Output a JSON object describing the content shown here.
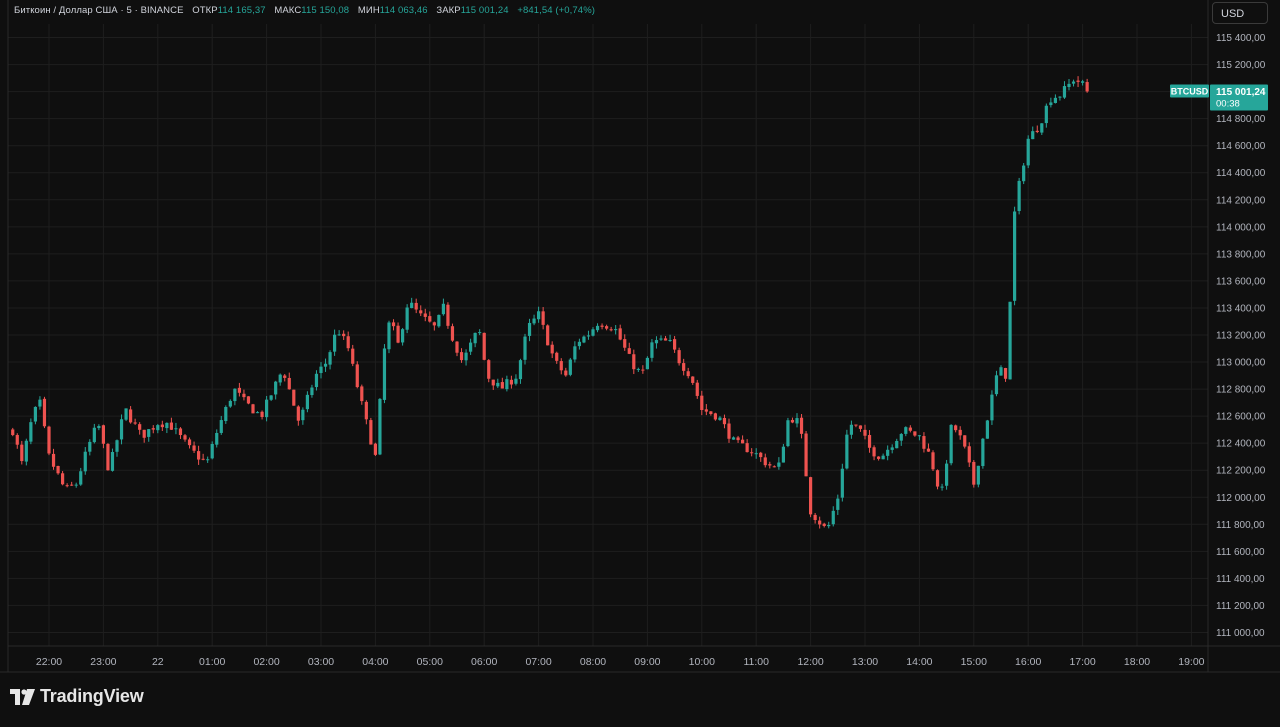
{
  "header": {
    "symbol_desc": "Биткоин / Доллар США · 5 · BINANCE",
    "open_label": "ОТКР",
    "open_value": "114 165,37",
    "high_label": "МАКС",
    "high_value": "115 150,08",
    "low_label": "МИН",
    "low_value": "114 063,46",
    "close_label": "ЗАКР",
    "close_value": "115 001,24",
    "change": "+841,54 (+0,74%)",
    "currency_button": "USD"
  },
  "price_tag": {
    "symbol": "BTCUSD",
    "price": "115 001,24",
    "countdown": "00:38"
  },
  "brand": {
    "name": "TradingView"
  },
  "colors": {
    "up": "#26a69a",
    "down": "#ef5350",
    "background": "#0f0f0f",
    "grid": "#1e1e1e"
  },
  "chart_data": {
    "type": "candlestick",
    "ylim": [
      110900,
      115500
    ],
    "y_ticks": [
      "111 000,00",
      "111 200,00",
      "111 400,00",
      "111 600,00",
      "111 800,00",
      "112 000,00",
      "112 200,00",
      "112 400,00",
      "112 600,00",
      "112 800,00",
      "113 000,00",
      "113 200,00",
      "113 400,00",
      "113 600,00",
      "113 800,00",
      "114 000,00",
      "114 200,00",
      "114 400,00",
      "114 600,00",
      "114 800,00",
      "115 000,00",
      "115 200,00",
      "115 400,00"
    ],
    "y_tick_values": [
      111000,
      111200,
      111400,
      111600,
      111800,
      112000,
      112200,
      112400,
      112600,
      112800,
      113000,
      113200,
      113400,
      113600,
      113800,
      114000,
      114200,
      114400,
      114600,
      114800,
      115000,
      115200,
      115400
    ],
    "x_ticks": [
      "22:00",
      "23:00",
      "22",
      "01:00",
      "02:00",
      "03:00",
      "04:00",
      "05:00",
      "06:00",
      "07:00",
      "08:00",
      "09:00",
      "10:00",
      "11:00",
      "12:00",
      "13:00",
      "14:00",
      "15:00",
      "16:00",
      "17:00",
      "18:00",
      "19:00"
    ],
    "x_tick_hours": [
      22,
      23,
      24,
      25,
      26,
      27,
      28,
      29,
      30,
      31,
      32,
      33,
      34,
      35,
      36,
      37,
      38,
      39,
      40,
      41,
      42,
      43
    ],
    "interval_minutes": 5,
    "first_candle_time": "21:20",
    "path_hours": [
      21.33,
      21.5,
      21.7,
      21.83,
      22.0,
      22.3,
      22.5,
      22.7,
      22.9,
      23.1,
      23.4,
      23.7,
      24.0,
      24.2,
      24.4,
      24.6,
      24.9,
      25.1,
      25.4,
      25.6,
      25.9,
      26.3,
      26.6,
      26.9,
      27.1,
      27.3,
      27.5,
      27.8,
      28.0,
      28.2,
      28.3,
      28.4,
      28.6,
      28.8,
      29.1,
      29.25,
      29.4,
      29.6,
      29.9,
      30.05,
      30.3,
      30.6,
      30.8,
      31.0,
      31.3,
      31.5,
      31.7,
      31.9,
      32.1,
      32.4,
      32.7,
      32.9,
      33.1,
      33.4,
      33.6,
      33.8,
      34.0,
      34.3,
      34.6,
      34.9,
      35.2,
      35.4,
      35.6,
      35.8,
      36.0,
      36.3,
      36.5,
      36.7,
      36.9,
      37.1,
      37.3,
      37.7,
      38.0,
      38.2,
      38.4,
      38.6,
      38.8,
      39.0,
      39.2,
      39.45,
      39.6,
      39.75,
      39.85,
      40.0,
      40.2,
      40.4,
      40.6,
      40.75,
      40.85,
      41.0,
      41.1
    ],
    "path_prices": [
      112500,
      112250,
      112600,
      112700,
      112300,
      112050,
      112100,
      112350,
      112550,
      112200,
      112650,
      112450,
      112550,
      112550,
      112450,
      112350,
      112250,
      112500,
      112800,
      112700,
      112600,
      112950,
      112550,
      112900,
      113000,
      113250,
      113100,
      112600,
      112300,
      113250,
      113300,
      113100,
      113450,
      113350,
      113250,
      113400,
      113200,
      113000,
      113250,
      112900,
      112800,
      112900,
      113250,
      113350,
      113000,
      112900,
      113150,
      113200,
      113300,
      113250,
      113000,
      112900,
      113150,
      113150,
      113000,
      112900,
      112650,
      112600,
      112400,
      112350,
      112250,
      112200,
      112600,
      112550,
      111900,
      111750,
      112000,
      112550,
      112500,
      112350,
      112300,
      112500,
      112450,
      112300,
      112000,
      112550,
      112400,
      112100,
      112500,
      112950,
      112900,
      114100,
      114350,
      114650,
      114750,
      114950,
      114980,
      115050,
      115100,
      115050,
      115001
    ],
    "last_price": 115001.24
  }
}
